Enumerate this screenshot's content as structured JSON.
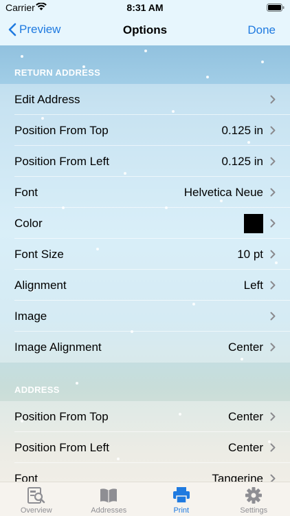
{
  "status_bar": {
    "carrier": "Carrier",
    "time": "8:31 AM"
  },
  "nav": {
    "back_label": "Preview",
    "title": "Options",
    "done_label": "Done"
  },
  "sections": {
    "return_address": {
      "title": "RETURN ADDRESS",
      "rows": [
        {
          "label": "Edit Address",
          "value": ""
        },
        {
          "label": "Position From Top",
          "value": "0.125 in"
        },
        {
          "label": "Position From Left",
          "value": "0.125 in"
        },
        {
          "label": "Font",
          "value": "Helvetica Neue"
        },
        {
          "label": "Color",
          "value": "",
          "swatch_color": "#000000"
        },
        {
          "label": "Font Size",
          "value": "10 pt"
        },
        {
          "label": "Alignment",
          "value": "Left"
        },
        {
          "label": "Image",
          "value": ""
        },
        {
          "label": "Image Alignment",
          "value": "Center"
        }
      ]
    },
    "address": {
      "title": "ADDRESS",
      "rows": [
        {
          "label": "Position From Top",
          "value": "Center"
        },
        {
          "label": "Position From Left",
          "value": "Center"
        },
        {
          "label": "Font",
          "value": "Tangerine"
        }
      ]
    }
  },
  "tabs": [
    {
      "label": "Overview",
      "icon": "overview-icon",
      "active": false
    },
    {
      "label": "Addresses",
      "icon": "book-icon",
      "active": false
    },
    {
      "label": "Print",
      "icon": "printer-icon",
      "active": true
    },
    {
      "label": "Settings",
      "icon": "gear-icon",
      "active": false
    }
  ],
  "colors": {
    "accent": "#1f7ae0",
    "inactive": "#8e8e93"
  }
}
